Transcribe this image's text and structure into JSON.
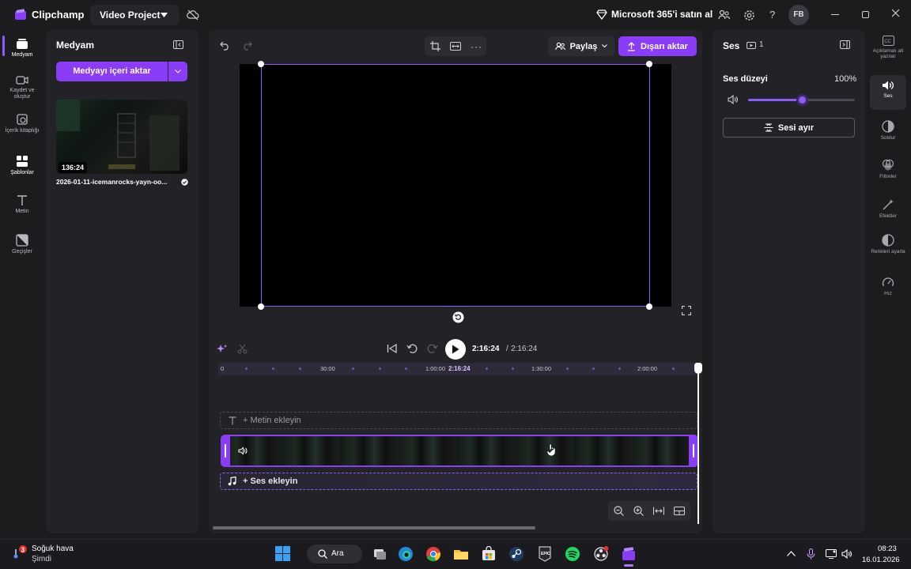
{
  "titlebar": {
    "app_name": "Clipchamp",
    "project_name": "Video Project",
    "ms365_offer": "Microsoft 365'i satın al",
    "avatar_initials": "FB"
  },
  "left_rail": {
    "items": [
      {
        "label": "Medyam",
        "icon": "media-icon"
      },
      {
        "label": "Kaydet ve oluştur",
        "icon": "record-icon"
      },
      {
        "label": "İçerik kitaplığı",
        "icon": "content-library-icon"
      },
      {
        "label": "Şablonlar",
        "icon": "templates-icon"
      },
      {
        "label": "Metin",
        "icon": "text-icon"
      },
      {
        "label": "Geçişler",
        "icon": "transitions-icon"
      }
    ]
  },
  "media_panel": {
    "title": "Medyam",
    "import_label": "Medyayı içeri aktar",
    "asset": {
      "duration": "136:24",
      "name": "2026-01-11-icemanrocks-yayn-oo..."
    }
  },
  "toolbar": {
    "share_label": "Paylaş",
    "export_label": "Dışarı aktar"
  },
  "playback": {
    "current_time": "2:16:24",
    "separator": "/",
    "total_time": "2:16:24"
  },
  "timeline": {
    "ticks": [
      "0",
      "30:00",
      "1:00:00",
      "2:16:24",
      "1:30:00",
      "2:00:00"
    ],
    "text_track_label": "+ Metin ekleyin",
    "audio_track_label": "+ Ses ekleyin"
  },
  "right_panel": {
    "title": "Ses",
    "clip_count": "1",
    "volume_label": "Ses düzeyi",
    "volume_value": "100%",
    "volume_fraction": 0.5,
    "split_audio_label": "Sesi ayır"
  },
  "right_rail": {
    "items": [
      {
        "label": "Açıklamalı alt yazılar",
        "icon": "captions-icon"
      },
      {
        "label": "Ses",
        "icon": "audio-icon"
      },
      {
        "label": "Soldur",
        "icon": "fade-icon"
      },
      {
        "label": "Filtreler",
        "icon": "filters-icon"
      },
      {
        "label": "Efektler",
        "icon": "effects-icon"
      },
      {
        "label": "Renkleri ayarla",
        "icon": "adjust-colors-icon"
      },
      {
        "label": "Hız",
        "icon": "speed-icon"
      }
    ]
  },
  "taskbar": {
    "weather_title": "Soğuk hava",
    "weather_sub": "Şimdi",
    "search_label": "Ara",
    "time": "08:23",
    "date": "16.01.2026",
    "notification_badge": "3"
  },
  "colors": {
    "accent": "#8b3cf7",
    "panel": "#232327",
    "background": "#1c1c1f"
  }
}
